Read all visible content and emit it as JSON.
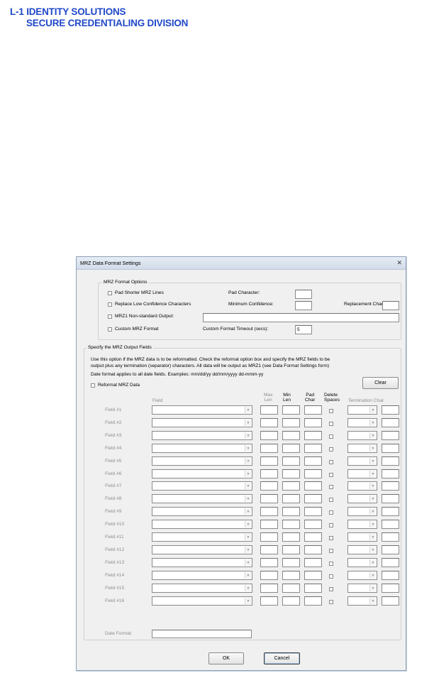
{
  "header": {
    "line1": "L-1 IDENTITY SOLUTIONS",
    "line2": "SECURE CREDENTIALING DIVISION"
  },
  "dialog": {
    "title": "MRZ Data Format Settings",
    "close_glyph": "✕",
    "format_options": {
      "group_label": "MRZ Format Options",
      "pad_shorter": "Pad Shorter MRZ Lines",
      "pad_character": "Pad Character:",
      "replace_low": "Replace Low Confidence Characters",
      "min_confidence": "Minimum Confidence:",
      "replacement_char": "Replacement Char:",
      "mrz1_nonstandard": "MRZ1 Non-standard Output:",
      "custom_format": "Custom MRZ Format",
      "custom_timeout": "Custom Format Timeout (secs):",
      "custom_timeout_value": "5"
    },
    "output_fields": {
      "group_label": "Specify the MRZ Output Fields",
      "desc1": "Use this option if the MRZ data is to be reformatted. Check the reformat option box and specify the MRZ fields to be",
      "desc2": "output plus any termination (separator) characters. All data will be output as MRZ1 (see Data Format Settings form)",
      "desc3": "Date format applies to all date fields. Examples: mm/dd/yy  dd/mm/yyyy  dd-mmm-yy",
      "reformat": "Reformat MRZ Data",
      "clear": "Clear",
      "col_field": "Field",
      "col_max": "Max\nLen",
      "col_min": "Min\nLen",
      "col_pad": "Pad\nChar",
      "col_delete": "Delete\nSpaces",
      "col_term": "Termination Char.",
      "rows": [
        "Field #1",
        "Field #2",
        "Field #3",
        "Field #4",
        "Field #5",
        "Field #6",
        "Field #7",
        "Field #8",
        "Field #9",
        "Field #10",
        "Field #11",
        "Field #12",
        "Field #13",
        "Field #14",
        "Field #15",
        "Field #16"
      ],
      "date_format": "Date Format:"
    },
    "ok": "OK",
    "cancel": "Cancel"
  }
}
